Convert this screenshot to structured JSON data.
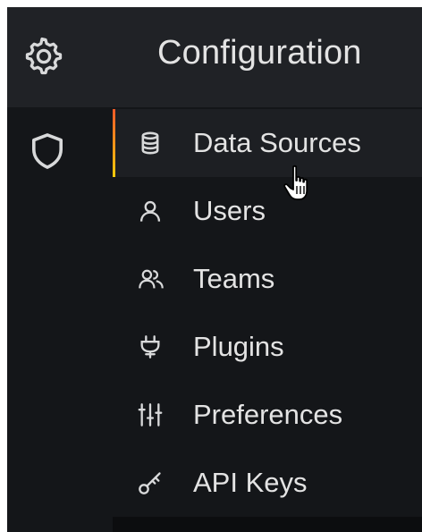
{
  "rail": {
    "icons": [
      "gear-icon",
      "shield-icon"
    ]
  },
  "flyout": {
    "title": "Configuration",
    "items": [
      {
        "label": "Data Sources",
        "icon": "database-icon",
        "active": true
      },
      {
        "label": "Users",
        "icon": "user-icon",
        "active": false
      },
      {
        "label": "Teams",
        "icon": "users-icon",
        "active": false
      },
      {
        "label": "Plugins",
        "icon": "plug-icon",
        "active": false
      },
      {
        "label": "Preferences",
        "icon": "sliders-icon",
        "active": false
      },
      {
        "label": "API Keys",
        "icon": "key-icon",
        "active": false
      }
    ]
  },
  "colors": {
    "background": "#141619",
    "header": "#202226",
    "active_item": "#1d1f23",
    "text": "#e3e3e3",
    "accent_top": "#f05a28",
    "accent_bottom": "#fbca0a"
  }
}
